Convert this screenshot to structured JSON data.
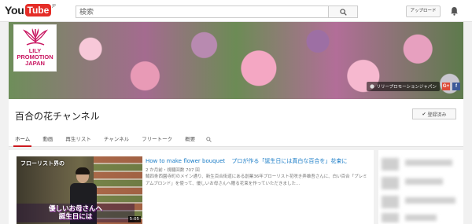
{
  "masthead": {
    "logo_you": "You",
    "logo_tube": "Tube",
    "logo_region": "JP",
    "search_placeholder": "検索",
    "upload_label": "アップロード",
    "icons": [
      "search-icon",
      "bell-icon"
    ]
  },
  "banner": {
    "logo_lines": [
      "LILY",
      "PROMOTION",
      "JAPAN"
    ],
    "link_label": "リリープロモーションジャパン",
    "social": [
      "G+",
      "f"
    ],
    "colors": {
      "logo_text": "#c81560",
      "gplus": "#dd4b39",
      "facebook": "#3b5998"
    }
  },
  "channel": {
    "title": "百合の花チャンネル",
    "subscribed_label": "登録済み",
    "tabs": [
      "ホーム",
      "動画",
      "再生リスト",
      "チャンネル",
      "フリートーク",
      "概要"
    ],
    "active_tab": "ホーム"
  },
  "featured": {
    "thumb_top_text": "フローリスト界の",
    "thumb_caption_1": "優しいお母さんへ",
    "thumb_caption_2": "誕生日には",
    "duration": "5:05",
    "title_en": "How to make flower bouquet",
    "title_jp": "プロが作る「誕生日には真白な百合を」花束に",
    "meta": "2 か月前・視聴回数 707 回",
    "description": "鯖四条西園寺町のメイン通り、新生百合街道にある創業36年プローリスト花咲き弄雄吾さんに、白い百合「プレミアムブロンド」を使って、優しいお母さんへ贈る花束を作っていただきました…"
  },
  "colors": {
    "youtube_red": "#e52d27",
    "link_blue": "#167ac6",
    "tab_underline": "#cc181e"
  }
}
